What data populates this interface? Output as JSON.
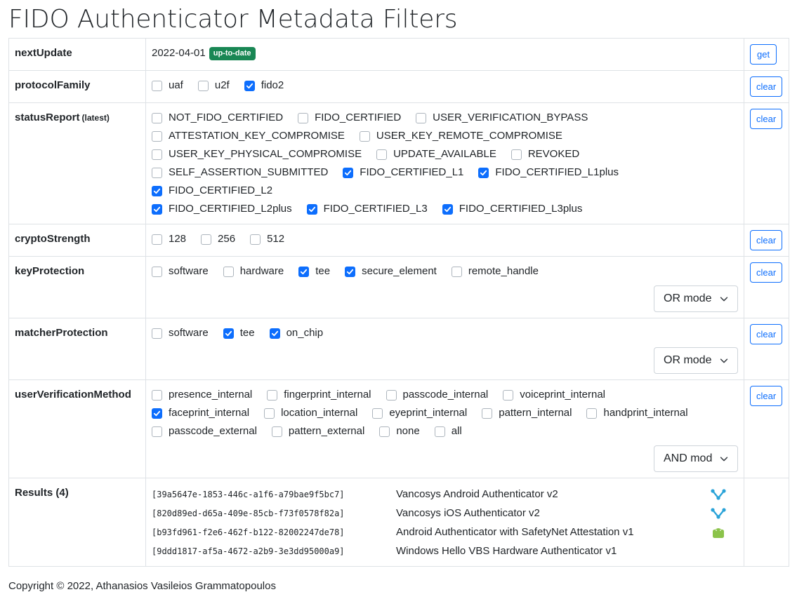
{
  "page_title": "FIDO Authenticator Metadata Filters",
  "next_update": {
    "label": "nextUpdate",
    "date": "2022-04-01",
    "badge": "up-to-date",
    "badge_color": "#198754",
    "button": "get"
  },
  "clear_label": "clear",
  "filters": [
    {
      "key": "protocolFamily",
      "label": "protocolFamily",
      "options": [
        {
          "label": "uaf",
          "checked": false
        },
        {
          "label": "u2f",
          "checked": false
        },
        {
          "label": "fido2",
          "checked": true
        }
      ]
    },
    {
      "key": "statusReport",
      "label": "statusReport",
      "sublabel": "(latest)",
      "lines": [
        [
          {
            "label": "NOT_FIDO_CERTIFIED",
            "checked": false
          },
          {
            "label": "FIDO_CERTIFIED",
            "checked": false
          },
          {
            "label": "USER_VERIFICATION_BYPASS",
            "checked": false
          }
        ],
        [
          {
            "label": "ATTESTATION_KEY_COMPROMISE",
            "checked": false
          },
          {
            "label": "USER_KEY_REMOTE_COMPROMISE",
            "checked": false
          }
        ],
        [
          {
            "label": "USER_KEY_PHYSICAL_COMPROMISE",
            "checked": false
          },
          {
            "label": "UPDATE_AVAILABLE",
            "checked": false
          },
          {
            "label": "REVOKED",
            "checked": false
          }
        ],
        [
          {
            "label": "SELF_ASSERTION_SUBMITTED",
            "checked": false
          },
          {
            "label": "FIDO_CERTIFIED_L1",
            "checked": true
          },
          {
            "label": "FIDO_CERTIFIED_L1plus",
            "checked": true
          },
          {
            "label": "FIDO_CERTIFIED_L2",
            "checked": true
          }
        ],
        [
          {
            "label": "FIDO_CERTIFIED_L2plus",
            "checked": true
          },
          {
            "label": "FIDO_CERTIFIED_L3",
            "checked": true
          },
          {
            "label": "FIDO_CERTIFIED_L3plus",
            "checked": true
          }
        ]
      ]
    },
    {
      "key": "cryptoStrength",
      "label": "cryptoStrength",
      "options": [
        {
          "label": "128",
          "checked": false
        },
        {
          "label": "256",
          "checked": false
        },
        {
          "label": "512",
          "checked": false
        }
      ]
    },
    {
      "key": "keyProtection",
      "label": "keyProtection",
      "options": [
        {
          "label": "software",
          "checked": false
        },
        {
          "label": "hardware",
          "checked": false
        },
        {
          "label": "tee",
          "checked": true
        },
        {
          "label": "secure_element",
          "checked": true
        },
        {
          "label": "remote_handle",
          "checked": false
        }
      ],
      "mode": "OR mode"
    },
    {
      "key": "matcherProtection",
      "label": "matcherProtection",
      "options": [
        {
          "label": "software",
          "checked": false
        },
        {
          "label": "tee",
          "checked": true
        },
        {
          "label": "on_chip",
          "checked": true
        }
      ],
      "mode": "OR mode"
    },
    {
      "key": "userVerificationMethod",
      "label": "userVerificationMethod",
      "lines": [
        [
          {
            "label": "presence_internal",
            "checked": false
          },
          {
            "label": "fingerprint_internal",
            "checked": false
          },
          {
            "label": "passcode_internal",
            "checked": false
          },
          {
            "label": "voiceprint_internal",
            "checked": false
          }
        ],
        [
          {
            "label": "faceprint_internal",
            "checked": true
          },
          {
            "label": "location_internal",
            "checked": false
          },
          {
            "label": "eyeprint_internal",
            "checked": false
          },
          {
            "label": "pattern_internal",
            "checked": false
          },
          {
            "label": "handprint_internal",
            "checked": false
          }
        ],
        [
          {
            "label": "passcode_external",
            "checked": false
          },
          {
            "label": "pattern_external",
            "checked": false
          },
          {
            "label": "none",
            "checked": false
          },
          {
            "label": "all",
            "checked": false
          }
        ]
      ],
      "mode": "AND mod"
    }
  ],
  "results": {
    "label": "Results (4)",
    "items": [
      {
        "id": "[39a5647e-1853-446c-a1f6-a79bae9f5bc7]",
        "name": "Vancosys Android Authenticator v2",
        "icon": "vancosys-logo-icon"
      },
      {
        "id": "[820d89ed-d65a-409e-85cb-f73f0578f82a]",
        "name": "Vancosys iOS Authenticator v2",
        "icon": "vancosys-logo-icon"
      },
      {
        "id": "[b93fd961-f2e6-462f-b122-82002247de78]",
        "name": "Android Authenticator with SafetyNet Attestation v1",
        "icon": "android-icon"
      },
      {
        "id": "[9ddd1817-af5a-4672-a2b9-3e3dd95000a9]",
        "name": "Windows Hello VBS Hardware Authenticator v1",
        "icon": ""
      }
    ]
  },
  "footer": "Copyright © 2022, Athanasios Vasileios Grammatopoulos",
  "colors": {
    "primary": "#0d6efd",
    "success": "#198754",
    "border": "#dee2e6",
    "vancosys": "#2aa3d8",
    "android": "#8bc34a"
  }
}
